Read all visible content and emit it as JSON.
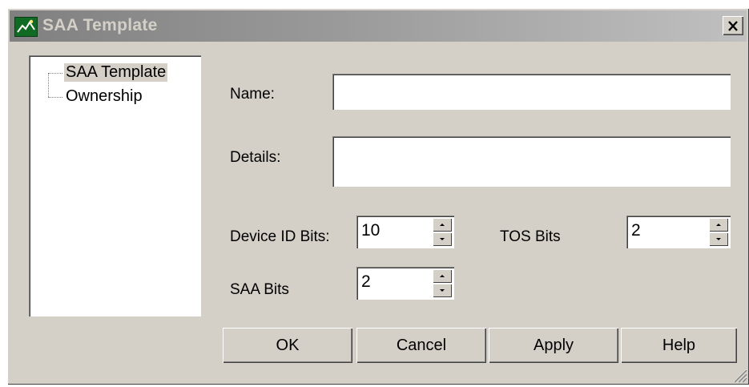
{
  "window": {
    "title": "SAA Template",
    "icon": "saa-app-icon",
    "close_label": "✕"
  },
  "tree": {
    "items": [
      {
        "label": "SAA Template",
        "selected": true
      },
      {
        "label": "Ownership",
        "selected": false
      }
    ]
  },
  "form": {
    "name_label": "Name:",
    "name_value": "",
    "details_label": "Details:",
    "details_value": "",
    "device_id_bits_label": "Device ID Bits:",
    "device_id_bits_value": "10",
    "tos_bits_label": "TOS Bits",
    "tos_bits_value": "2",
    "saa_bits_label": "SAA Bits",
    "saa_bits_value": "2"
  },
  "buttons": {
    "ok": "OK",
    "cancel": "Cancel",
    "apply": "Apply",
    "help": "Help"
  },
  "colors": {
    "dialog_bg": "#d4d0c8",
    "title_gradient_start": "#808080",
    "title_gradient_end": "#c0c0c0",
    "title_text": "#d4d0c8"
  }
}
